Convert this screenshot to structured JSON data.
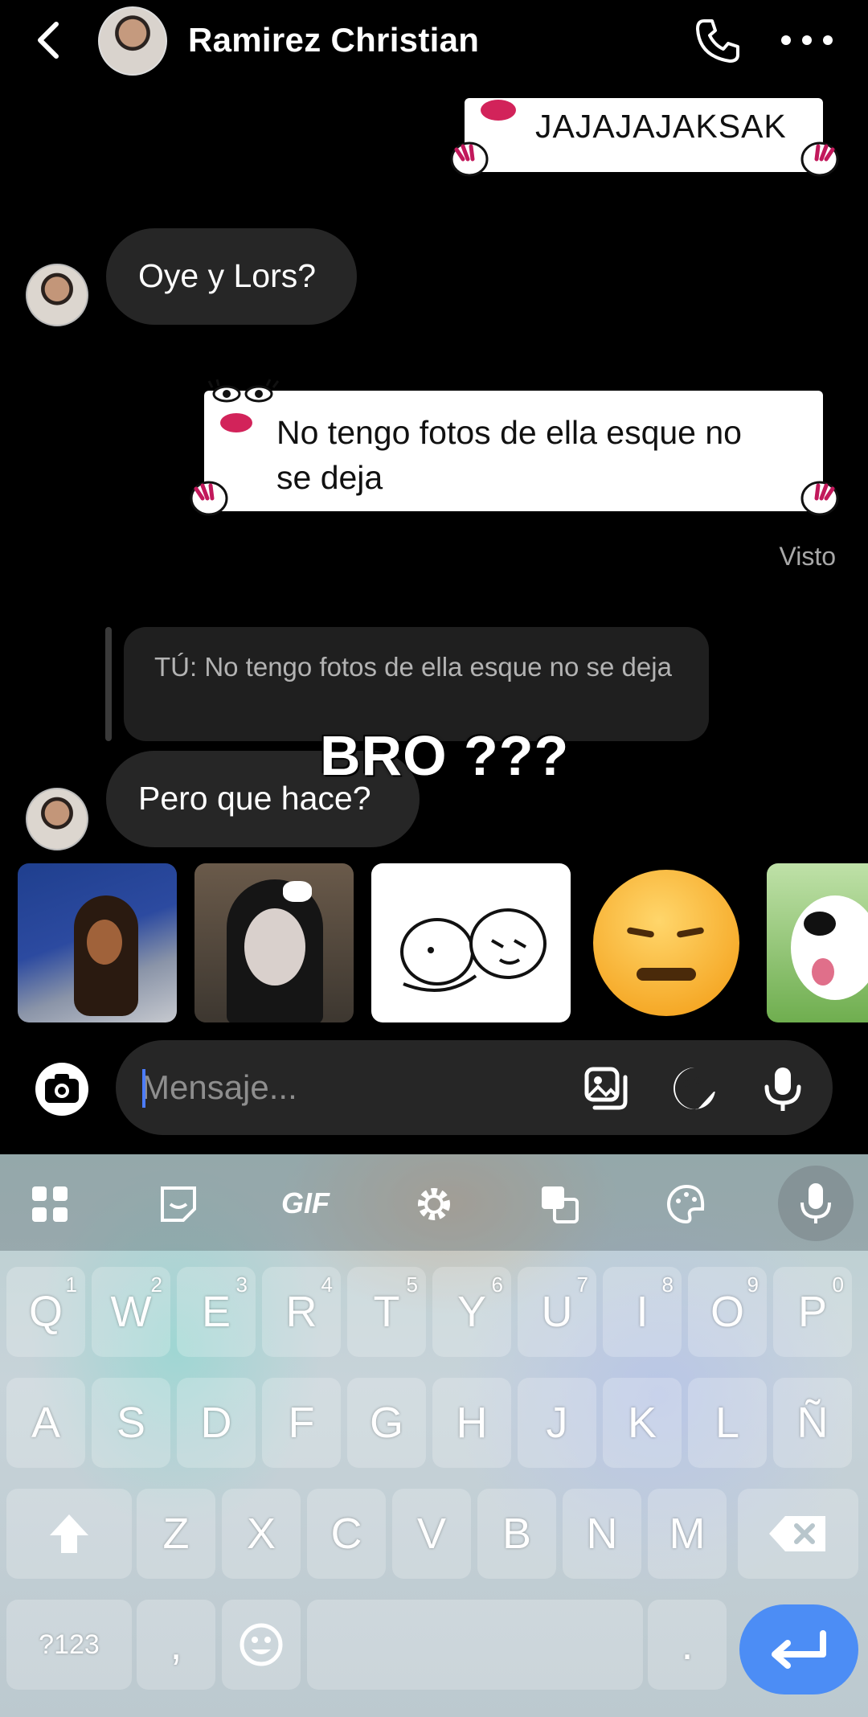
{
  "header": {
    "contact_name": "Ramirez Christian"
  },
  "messages": {
    "sent_1": "JAJAJAJAKSAK",
    "received_1": "Oye y Lors?",
    "sent_2_line1": "No tengo fotos de ella esque no",
    "sent_2_line2": "se deja",
    "seen_label": "Visto",
    "reply_quote": "TÚ: No tengo fotos de ella esque no se deja",
    "received_2": "Pero que hace?"
  },
  "overlay": {
    "text": "BRO ???"
  },
  "composer": {
    "placeholder": "Mensaje..."
  },
  "keyboard": {
    "toolbar_gif": "GIF",
    "row1": [
      "Q",
      "W",
      "E",
      "R",
      "T",
      "Y",
      "U",
      "I",
      "O",
      "P"
    ],
    "row1_hints": [
      "1",
      "2",
      "3",
      "4",
      "5",
      "6",
      "7",
      "8",
      "9",
      "0"
    ],
    "row2": [
      "A",
      "S",
      "D",
      "F",
      "G",
      "H",
      "J",
      "K",
      "L",
      "Ñ"
    ],
    "row3": [
      "Z",
      "X",
      "C",
      "V",
      "B",
      "N",
      "M"
    ],
    "symbols_key": "?123",
    "comma_key": ",",
    "period_key": "."
  },
  "colors": {
    "accent_blue": "#4c8df5",
    "bubble_dark": "#262626",
    "lips_pink": "#d2235a"
  }
}
